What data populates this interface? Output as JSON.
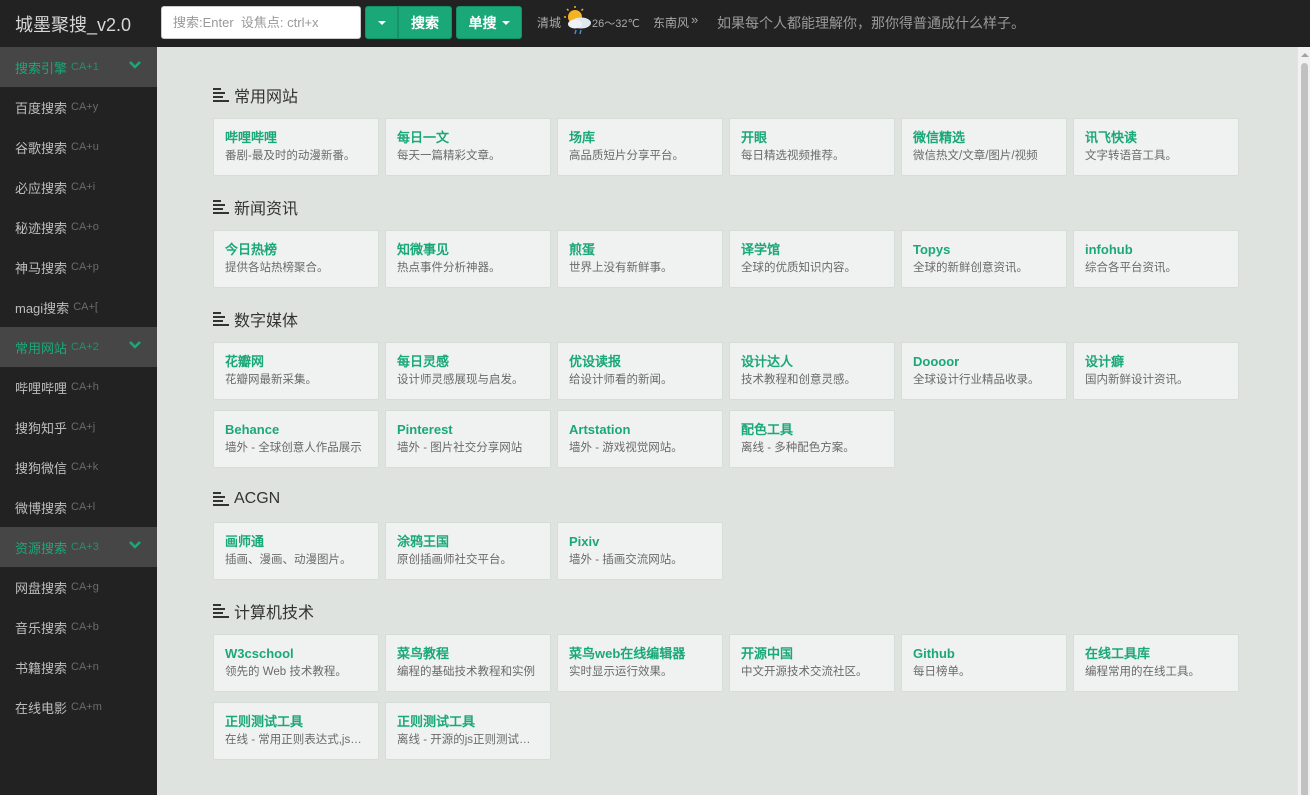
{
  "header": {
    "brand": "城墨聚搜_v2.0",
    "search_placeholder": "搜索:Enter  设焦点: ctrl+x",
    "search_button": "搜索",
    "single_button": "单搜",
    "city": "清城",
    "weather_icon": "partly-cloudy-rain-icon",
    "temperature": "26～32℃",
    "wind": "东南风",
    "more_glyph": "»",
    "quote": "如果每个人都能理解你，那你得普通成什么样子。"
  },
  "sidebar": {
    "items": [
      {
        "label": "搜索引擎",
        "key": "CA+1",
        "group": true
      },
      {
        "label": "百度搜索",
        "key": "CA+y"
      },
      {
        "label": "谷歌搜索",
        "key": "CA+u"
      },
      {
        "label": "必应搜索",
        "key": "CA+i"
      },
      {
        "label": "秘迹搜索",
        "key": "CA+o"
      },
      {
        "label": "神马搜索",
        "key": "CA+p"
      },
      {
        "label": "magi搜索",
        "key": "CA+["
      },
      {
        "label": "常用网站",
        "key": "CA+2",
        "group": true
      },
      {
        "label": "哔哩哔哩",
        "key": "CA+h"
      },
      {
        "label": "搜狗知乎",
        "key": "CA+j"
      },
      {
        "label": "搜狗微信",
        "key": "CA+k"
      },
      {
        "label": "微博搜索",
        "key": "CA+l"
      },
      {
        "label": "资源搜索",
        "key": "CA+3",
        "group": true
      },
      {
        "label": "网盘搜索",
        "key": "CA+g"
      },
      {
        "label": "音乐搜索",
        "key": "CA+b"
      },
      {
        "label": "书籍搜索",
        "key": "CA+n"
      },
      {
        "label": "在线电影",
        "key": "CA+m"
      }
    ]
  },
  "sections": [
    {
      "title": "常用网站",
      "cards": [
        {
          "title": "哔哩哔哩",
          "desc": "番剧-最及时的动漫新番。"
        },
        {
          "title": "每日一文",
          "desc": "每天一篇精彩文章。"
        },
        {
          "title": "场库",
          "desc": "高品质短片分享平台。"
        },
        {
          "title": "开眼",
          "desc": "每日精选视频推荐。"
        },
        {
          "title": "微信精选",
          "desc": "微信热文/文章/图片/视频"
        },
        {
          "title": "讯飞快读",
          "desc": "文字转语音工具。"
        }
      ]
    },
    {
      "title": "新闻资讯",
      "cards": [
        {
          "title": "今日热榜",
          "desc": "提供各站热榜聚合。"
        },
        {
          "title": "知微事见",
          "desc": "热点事件分析神器。"
        },
        {
          "title": "煎蛋",
          "desc": "世界上没有新鲜事。"
        },
        {
          "title": "译学馆",
          "desc": "全球的优质知识内容。"
        },
        {
          "title": "Topys",
          "desc": "全球的新鲜创意资讯。"
        },
        {
          "title": "infohub",
          "desc": "综合各平台资讯。"
        }
      ]
    },
    {
      "title": "数字媒体",
      "cards": [
        {
          "title": "花瓣网",
          "desc": "花瓣网最新采集。"
        },
        {
          "title": "每日灵感",
          "desc": "设计师灵感展现与启发。"
        },
        {
          "title": "优设读报",
          "desc": "给设计师看的新闻。"
        },
        {
          "title": "设计达人",
          "desc": "技术教程和创意灵感。"
        },
        {
          "title": "Doooor",
          "desc": "全球设计行业精品收录。"
        },
        {
          "title": "设计癖",
          "desc": "国内新鲜设计资讯。"
        },
        {
          "title": "Behance",
          "desc": "墙外 - 全球创意人作品展示"
        },
        {
          "title": "Pinterest",
          "desc": "墙外 - 图片社交分享网站"
        },
        {
          "title": "Artstation",
          "desc": "墙外 - 游戏视觉网站。"
        },
        {
          "title": "配色工具",
          "desc": "离线 - 多种配色方案。"
        }
      ]
    },
    {
      "title": "ACGN",
      "cards": [
        {
          "title": "画师通",
          "desc": "插画、漫画、动漫图片。"
        },
        {
          "title": "涂鸦王国",
          "desc": "原创插画师社交平台。"
        },
        {
          "title": "Pixiv",
          "desc": "墙外 - 插画交流网站。"
        }
      ]
    },
    {
      "title": "计算机技术",
      "cards": [
        {
          "title": "W3cschool",
          "desc": "领先的 Web 技术教程。"
        },
        {
          "title": "菜鸟教程",
          "desc": "编程的基础技术教程和实例"
        },
        {
          "title": "菜鸟web在线编辑器",
          "desc": "实时显示运行效果。"
        },
        {
          "title": "开源中国",
          "desc": "中文开源技术交流社区。"
        },
        {
          "title": "Github",
          "desc": "每日榜单。"
        },
        {
          "title": "在线工具库",
          "desc": "编程常用的在线工具。"
        },
        {
          "title": "正则测试工具",
          "desc": "在线 - 常用正则表达式,js正则"
        },
        {
          "title": "正则测试工具",
          "desc": "离线 - 开源的js正则测试工具"
        }
      ]
    }
  ],
  "colors": {
    "accent": "#1aa879",
    "sidebar_bg": "#222222",
    "group_bg": "#464646",
    "main_bg": "#dfe3e0",
    "card_bg": "#f0f2f1"
  }
}
